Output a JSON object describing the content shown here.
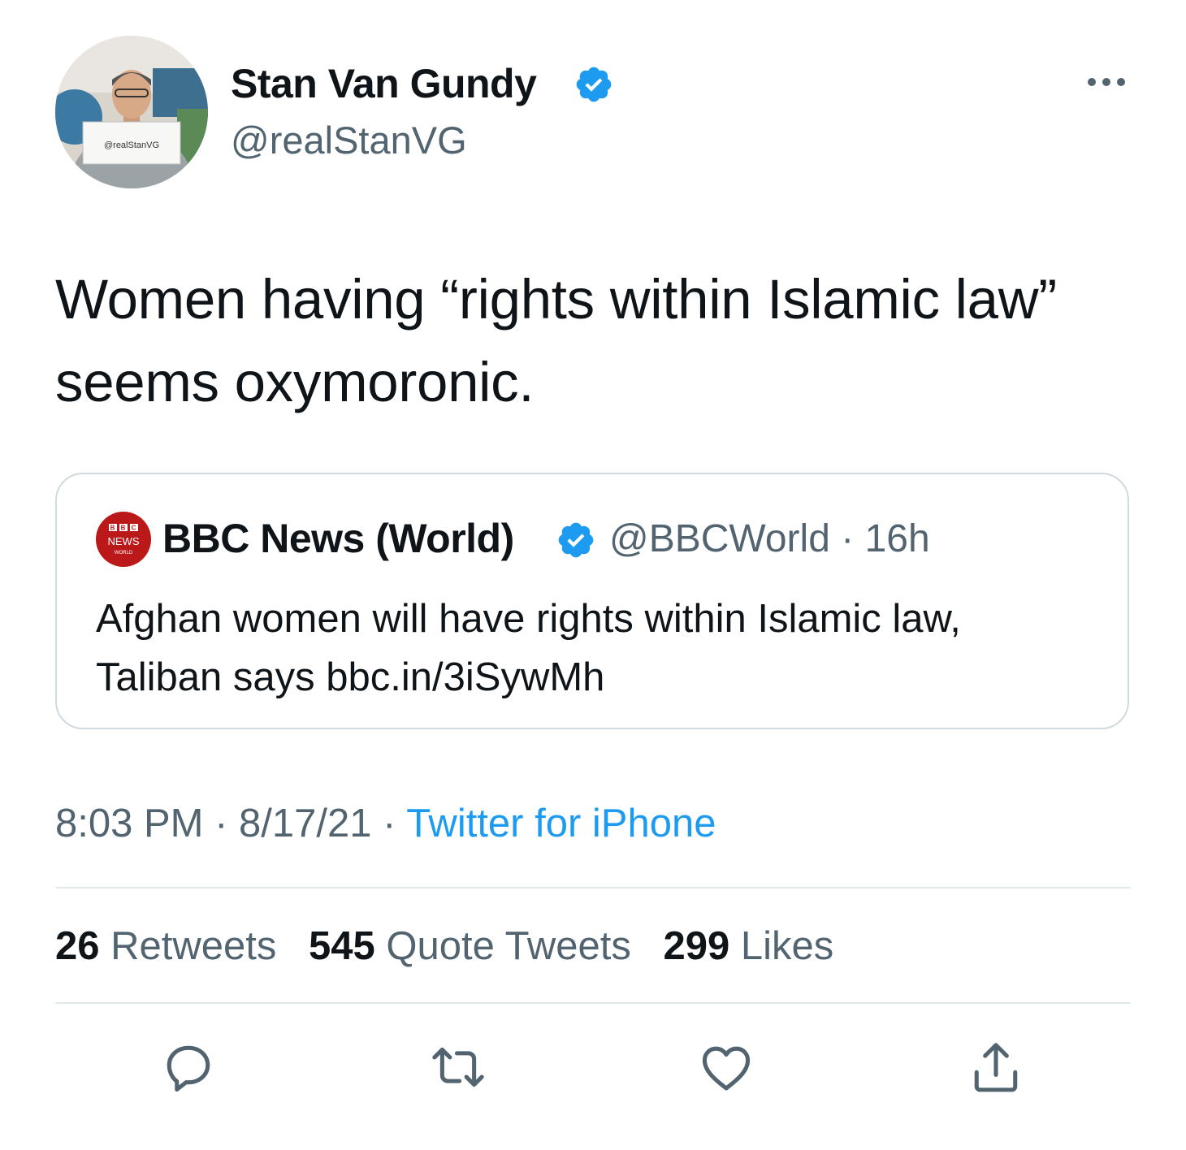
{
  "tweet": {
    "author": {
      "display_name": "Stan Van Gundy",
      "handle": "@realStanVG",
      "avatar_sign_text": "@realStanVG",
      "verified": true
    },
    "text": "Women having “rights within Islamic law” seems oxymoronic.",
    "more_icon": "more-horizontal-icon"
  },
  "quote": {
    "logo_text": "BBC NEWS WORLD",
    "display_name": "BBC News (World)",
    "verified": true,
    "handle": "@BBCWorld",
    "separator": " · ",
    "time_ago": "16h",
    "text": "Afghan women will have rights within Islamic law, Taliban says bbc.in/3iSywMh"
  },
  "meta": {
    "time": "8:03 PM",
    "date": "8/17/21",
    "separator": " · ",
    "source": "Twitter for iPhone"
  },
  "stats": {
    "retweets_count": "26",
    "retweets_label": "Retweets",
    "quotes_count": "545",
    "quotes_label": "Quote Tweets",
    "likes_count": "299",
    "likes_label": "Likes"
  },
  "actions": [
    "reply-icon",
    "retweet-icon",
    "like-icon",
    "share-icon"
  ],
  "colors": {
    "text": "#0f1419",
    "secondary": "#536471",
    "accent": "#1d9bf0",
    "border": "#cfd9de",
    "bbc_red": "#bb1919"
  }
}
